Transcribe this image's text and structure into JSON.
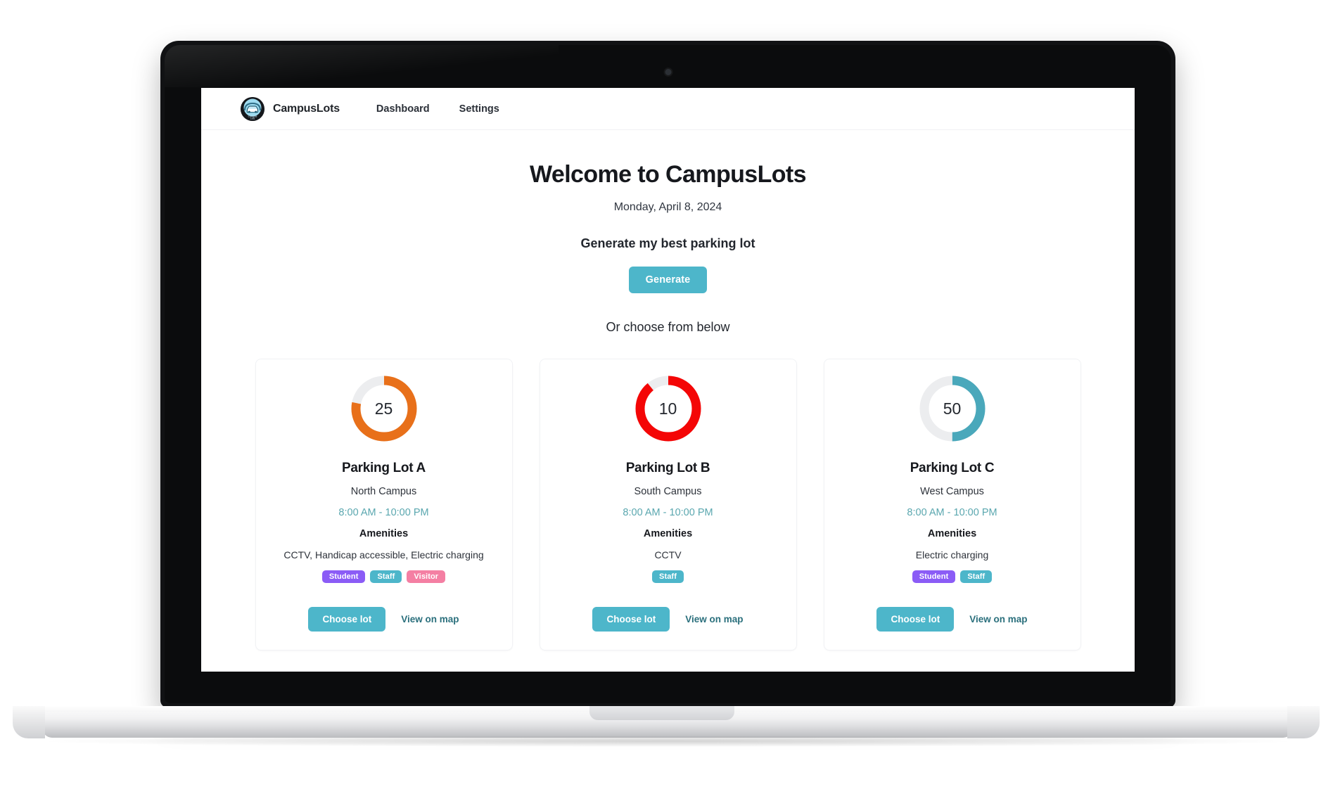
{
  "device": {
    "kind": "laptop-mockup",
    "camera_icon": "camera-dot-icon"
  },
  "navbar": {
    "logo_icon": "campuslots-car-logo-icon",
    "brand": "CampusLots",
    "links": [
      {
        "label": "Dashboard"
      },
      {
        "label": "Settings"
      }
    ]
  },
  "main": {
    "title": "Welcome to CampusLots",
    "date": "Monday, April 8, 2024",
    "generate_label": "Generate my best parking lot",
    "generate_button": "Generate",
    "or_label": "Or choose from below"
  },
  "colors": {
    "accent_teal": "#4db6ca",
    "link_teal": "#2a6f7c",
    "hours_teal": "#5aa7af",
    "donut_track": "#ecedef",
    "badge_student": "#8b5cf6",
    "badge_staff": "#4db6ca",
    "badge_visitor": "#f47fa3",
    "lot_a_ring": "#e8701a",
    "lot_b_ring": "#f40606",
    "lot_c_ring": "#4aa8bb"
  },
  "cards": [
    {
      "spots": "25",
      "percent": 78,
      "ring_color": "#e8701a",
      "title": "Parking Lot A",
      "campus": "North Campus",
      "hours": "8:00 AM - 10:00 PM",
      "amenities_heading": "Amenities",
      "amenities": "CCTV, Handicap accessible, Electric charging",
      "badges": [
        {
          "label": "Student",
          "color": "#8b5cf6"
        },
        {
          "label": "Staff",
          "color": "#4db6ca"
        },
        {
          "label": "Visitor",
          "color": "#f47fa3"
        }
      ],
      "choose_label": "Choose lot",
      "map_label": "View on map"
    },
    {
      "spots": "10",
      "percent": 89,
      "ring_color": "#f40606",
      "title": "Parking Lot B",
      "campus": "South Campus",
      "hours": "8:00 AM - 10:00 PM",
      "amenities_heading": "Amenities",
      "amenities": "CCTV",
      "badges": [
        {
          "label": "Staff",
          "color": "#4db6ca"
        }
      ],
      "choose_label": "Choose lot",
      "map_label": "View on map"
    },
    {
      "spots": "50",
      "percent": 50,
      "ring_color": "#4aa8bb",
      "title": "Parking Lot C",
      "campus": "West Campus",
      "hours": "8:00 AM - 10:00 PM",
      "amenities_heading": "Amenities",
      "amenities": "Electric charging",
      "badges": [
        {
          "label": "Student",
          "color": "#8b5cf6"
        },
        {
          "label": "Staff",
          "color": "#4db6ca"
        }
      ],
      "choose_label": "Choose lot",
      "map_label": "View on map"
    }
  ],
  "chart_data": {
    "type": "pie",
    "title": "Parking lot availability donuts",
    "charts": [
      {
        "name": "Parking Lot A",
        "center_label": "25",
        "filled_percent": 78,
        "remaining_percent": 22,
        "color": "#e8701a",
        "track_color": "#ecedef"
      },
      {
        "name": "Parking Lot B",
        "center_label": "10",
        "filled_percent": 89,
        "remaining_percent": 11,
        "color": "#f40606",
        "track_color": "#ecedef"
      },
      {
        "name": "Parking Lot C",
        "center_label": "50",
        "filled_percent": 50,
        "remaining_percent": 50,
        "color": "#4aa8bb",
        "track_color": "#ecedef"
      }
    ],
    "legend": [],
    "xlabel": "",
    "ylabel": ""
  }
}
